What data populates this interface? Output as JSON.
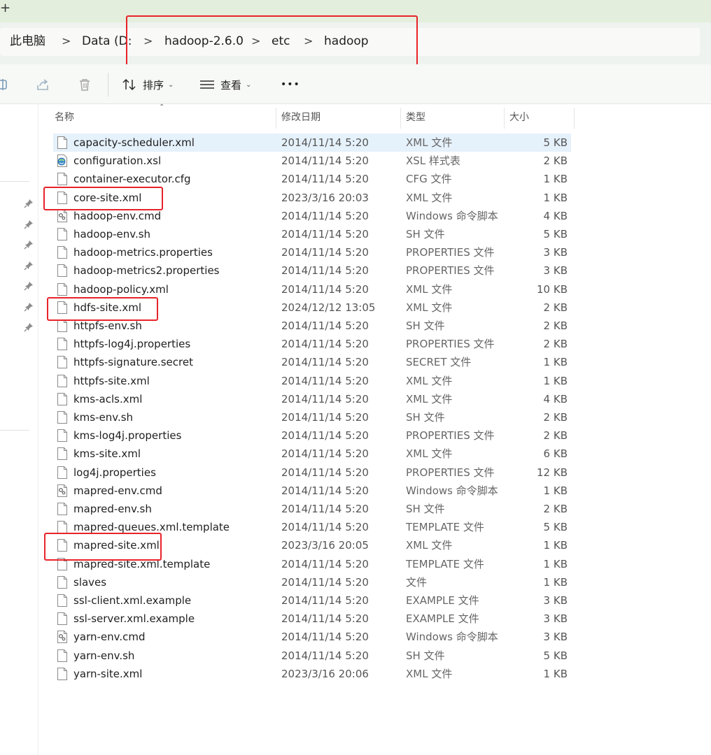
{
  "window": {
    "new_tab_glyph": "+"
  },
  "breadcrumb": [
    {
      "label": "此电脑"
    },
    {
      "label": "Data (D:"
    },
    {
      "label": "hadoop-2.6.0"
    },
    {
      "label": "etc"
    },
    {
      "label": "hadoop"
    }
  ],
  "breadcrumb_separator": ">",
  "toolbar": {
    "sort_label": "排序",
    "view_label": "查看",
    "more_label": "•••",
    "icons": [
      "rename-icon",
      "share-icon",
      "delete-icon",
      "sort-icon",
      "view-icon",
      "more-icon"
    ]
  },
  "columns": {
    "name": "名称",
    "date": "修改日期",
    "type": "类型",
    "size": "大小"
  },
  "files": [
    {
      "name": "capacity-scheduler.xml",
      "date": "2014/11/14 5:20",
      "type": "XML 文件",
      "size": "5 KB",
      "icon": "document-icon",
      "selected": true
    },
    {
      "name": "configuration.xsl",
      "date": "2014/11/14 5:20",
      "type": "XSL 样式表",
      "size": "2 KB",
      "icon": "stylesheet-icon"
    },
    {
      "name": "container-executor.cfg",
      "date": "2014/11/14 5:20",
      "type": "CFG 文件",
      "size": "1 KB",
      "icon": "document-icon"
    },
    {
      "name": "core-site.xml",
      "date": "2023/3/16 20:03",
      "type": "XML 文件",
      "size": "1 KB",
      "icon": "document-icon"
    },
    {
      "name": "hadoop-env.cmd",
      "date": "2014/11/14 5:20",
      "type": "Windows 命令脚本",
      "size": "4 KB",
      "icon": "script-gear-icon"
    },
    {
      "name": "hadoop-env.sh",
      "date": "2014/11/14 5:20",
      "type": "SH 文件",
      "size": "5 KB",
      "icon": "document-icon"
    },
    {
      "name": "hadoop-metrics.properties",
      "date": "2014/11/14 5:20",
      "type": "PROPERTIES 文件",
      "size": "3 KB",
      "icon": "document-icon"
    },
    {
      "name": "hadoop-metrics2.properties",
      "date": "2014/11/14 5:20",
      "type": "PROPERTIES 文件",
      "size": "3 KB",
      "icon": "document-icon"
    },
    {
      "name": "hadoop-policy.xml",
      "date": "2014/11/14 5:20",
      "type": "XML 文件",
      "size": "10 KB",
      "icon": "document-icon"
    },
    {
      "name": "hdfs-site.xml",
      "date": "2024/12/12 13:05",
      "type": "XML 文件",
      "size": "2 KB",
      "icon": "document-icon"
    },
    {
      "name": "httpfs-env.sh",
      "date": "2014/11/14 5:20",
      "type": "SH 文件",
      "size": "2 KB",
      "icon": "document-icon"
    },
    {
      "name": "httpfs-log4j.properties",
      "date": "2014/11/14 5:20",
      "type": "PROPERTIES 文件",
      "size": "2 KB",
      "icon": "document-icon"
    },
    {
      "name": "httpfs-signature.secret",
      "date": "2014/11/14 5:20",
      "type": "SECRET 文件",
      "size": "1 KB",
      "icon": "document-icon"
    },
    {
      "name": "httpfs-site.xml",
      "date": "2014/11/14 5:20",
      "type": "XML 文件",
      "size": "1 KB",
      "icon": "document-icon"
    },
    {
      "name": "kms-acls.xml",
      "date": "2014/11/14 5:20",
      "type": "XML 文件",
      "size": "4 KB",
      "icon": "document-icon"
    },
    {
      "name": "kms-env.sh",
      "date": "2014/11/14 5:20",
      "type": "SH 文件",
      "size": "2 KB",
      "icon": "document-icon"
    },
    {
      "name": "kms-log4j.properties",
      "date": "2014/11/14 5:20",
      "type": "PROPERTIES 文件",
      "size": "2 KB",
      "icon": "document-icon"
    },
    {
      "name": "kms-site.xml",
      "date": "2014/11/14 5:20",
      "type": "XML 文件",
      "size": "6 KB",
      "icon": "document-icon"
    },
    {
      "name": "log4j.properties",
      "date": "2014/11/14 5:20",
      "type": "PROPERTIES 文件",
      "size": "12 KB",
      "icon": "document-icon"
    },
    {
      "name": "mapred-env.cmd",
      "date": "2014/11/14 5:20",
      "type": "Windows 命令脚本",
      "size": "1 KB",
      "icon": "script-gear-icon"
    },
    {
      "name": "mapred-env.sh",
      "date": "2014/11/14 5:20",
      "type": "SH 文件",
      "size": "2 KB",
      "icon": "document-icon"
    },
    {
      "name": "mapred-queues.xml.template",
      "date": "2014/11/14 5:20",
      "type": "TEMPLATE 文件",
      "size": "5 KB",
      "icon": "document-icon"
    },
    {
      "name": "mapred-site.xml",
      "date": "2023/3/16 20:05",
      "type": "XML 文件",
      "size": "1 KB",
      "icon": "document-icon"
    },
    {
      "name": "mapred-site.xml.template",
      "date": "2014/11/14 5:20",
      "type": "TEMPLATE 文件",
      "size": "1 KB",
      "icon": "document-icon"
    },
    {
      "name": "slaves",
      "date": "2014/11/14 5:20",
      "type": "文件",
      "size": "1 KB",
      "icon": "document-icon"
    },
    {
      "name": "ssl-client.xml.example",
      "date": "2014/11/14 5:20",
      "type": "EXAMPLE 文件",
      "size": "3 KB",
      "icon": "document-icon"
    },
    {
      "name": "ssl-server.xml.example",
      "date": "2014/11/14 5:20",
      "type": "EXAMPLE 文件",
      "size": "3 KB",
      "icon": "document-icon"
    },
    {
      "name": "yarn-env.cmd",
      "date": "2014/11/14 5:20",
      "type": "Windows 命令脚本",
      "size": "3 KB",
      "icon": "script-gear-icon"
    },
    {
      "name": "yarn-env.sh",
      "date": "2014/11/14 5:20",
      "type": "SH 文件",
      "size": "5 KB",
      "icon": "document-icon"
    },
    {
      "name": "yarn-site.xml",
      "date": "2023/3/16 20:06",
      "type": "XML 文件",
      "size": "1 KB",
      "icon": "document-icon"
    }
  ],
  "colors": {
    "highlight_box": "#e8232a",
    "selection": "#e5f1fb",
    "titlebar": "#e4eedc"
  }
}
